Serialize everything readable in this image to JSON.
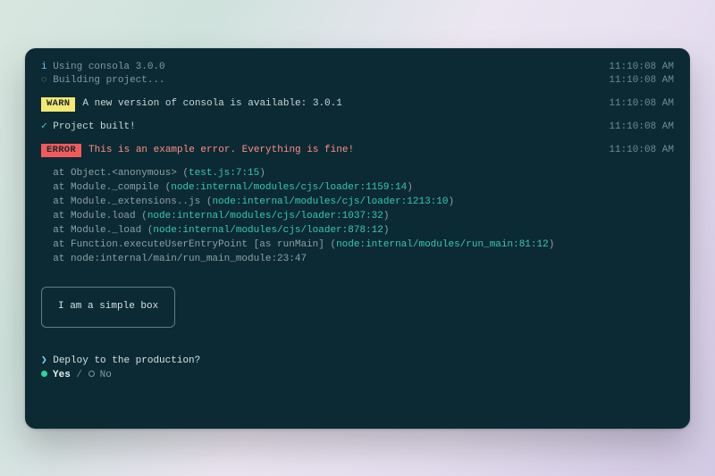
{
  "lines": {
    "info_icon": "i",
    "info_text": "Using consola 3.0.0",
    "building_icon": "◌",
    "building_text": "Building project...",
    "built_icon": "✓",
    "built_text": "Project built!"
  },
  "badges": {
    "warn": "WARN",
    "error": "ERROR"
  },
  "warn_text": "A new version of consola is available: 3.0.1",
  "error_text": "This is an example error. Everything is fine!",
  "timestamps": {
    "t1": "11:10:08 AM",
    "t2": "11:10:08 AM",
    "t3": "11:10:08 AM",
    "t4": "11:10:08 AM",
    "t5": "11:10:08 AM"
  },
  "trace": [
    {
      "at": "  at Object.<anonymous> (",
      "loc": "test.js:7:15",
      "tail": ")"
    },
    {
      "at": "  at Module._compile (",
      "loc": "node:internal/modules/cjs/loader:1159:14",
      "tail": ")"
    },
    {
      "at": "  at Module._extensions..js (",
      "loc": "node:internal/modules/cjs/loader:1213:10",
      "tail": ")"
    },
    {
      "at": "  at Module.load (",
      "loc": "node:internal/modules/cjs/loader:1037:32",
      "tail": ")"
    },
    {
      "at": "  at Module._load (",
      "loc": "node:internal/modules/cjs/loader:878:12",
      "tail": ")"
    },
    {
      "at": "  at Function.executeUserEntryPoint [as runMain] (",
      "loc": "node:internal/modules/run_main:81:12",
      "tail": ")"
    },
    {
      "at": "  at node:internal/main/run_main_module:23:47",
      "loc": "",
      "tail": ""
    }
  ],
  "box_text": "I am a simple box",
  "prompt": {
    "caret": "❯",
    "question": "Deploy to the production?",
    "yes": "Yes",
    "no": "No",
    "sep": " / "
  }
}
